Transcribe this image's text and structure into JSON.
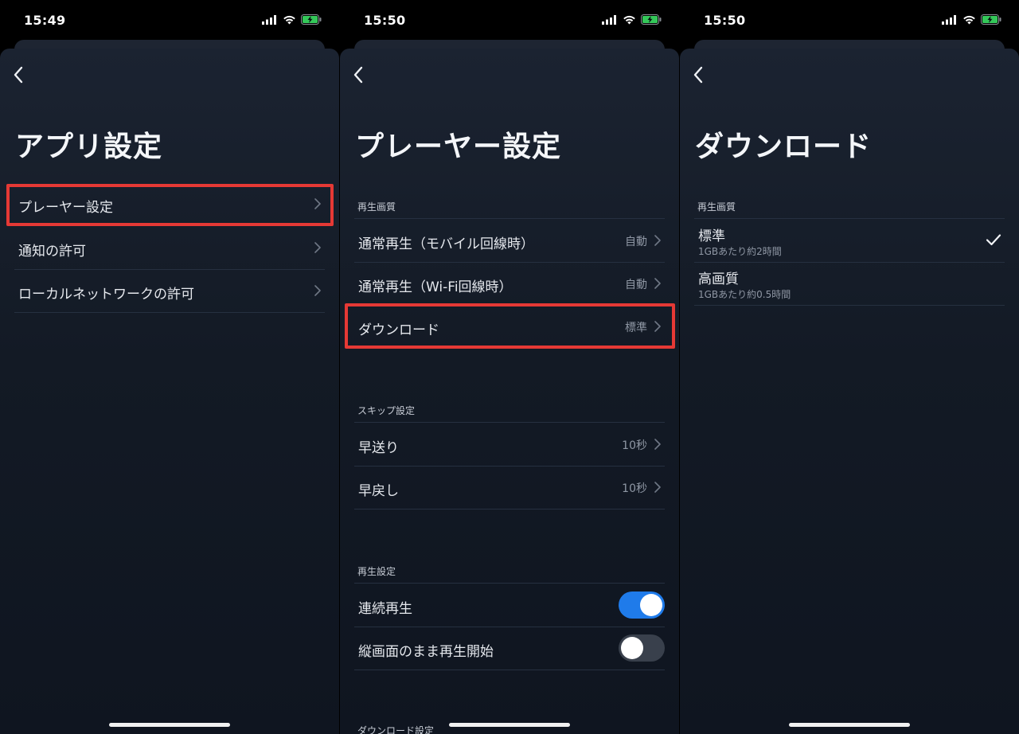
{
  "screens": [
    {
      "time": "15:49",
      "title": "アプリ設定",
      "items": [
        {
          "label": "プレーヤー設定"
        },
        {
          "label": "通知の許可"
        },
        {
          "label": "ローカルネットワークの許可"
        }
      ]
    },
    {
      "time": "15:50",
      "title": "プレーヤー設定",
      "sections": [
        {
          "label": "再生画質",
          "items": [
            {
              "label": "通常再生（モバイル回線時）",
              "value": "自動"
            },
            {
              "label": "通常再生（Wi-Fi回線時）",
              "value": "自動"
            },
            {
              "label": "ダウンロード",
              "value": "標準"
            }
          ]
        },
        {
          "label": "スキップ設定",
          "items": [
            {
              "label": "早送り",
              "value": "10秒"
            },
            {
              "label": "早戻し",
              "value": "10秒"
            }
          ]
        },
        {
          "label": "再生設定",
          "items": [
            {
              "label": "連続再生",
              "toggle": "on"
            },
            {
              "label": "縦画面のまま再生開始",
              "toggle": "off"
            }
          ]
        },
        {
          "label": "ダウンロード設定"
        }
      ]
    },
    {
      "time": "15:50",
      "title": "ダウンロード",
      "section_label": "再生画質",
      "options": [
        {
          "label": "標準",
          "sub": "1GBあたり約2時間",
          "selected": true
        },
        {
          "label": "高画質",
          "sub": "1GBあたり約0.5時間",
          "selected": false
        }
      ]
    }
  ],
  "colors": {
    "highlight": "#e53935",
    "toggle_on": "#1f7bea",
    "battery": "#34c759"
  },
  "icons": [
    "signal-icon",
    "wifi-icon",
    "battery-charging-icon",
    "back-chevron-icon",
    "chevron-right-icon",
    "checkmark-icon"
  ]
}
